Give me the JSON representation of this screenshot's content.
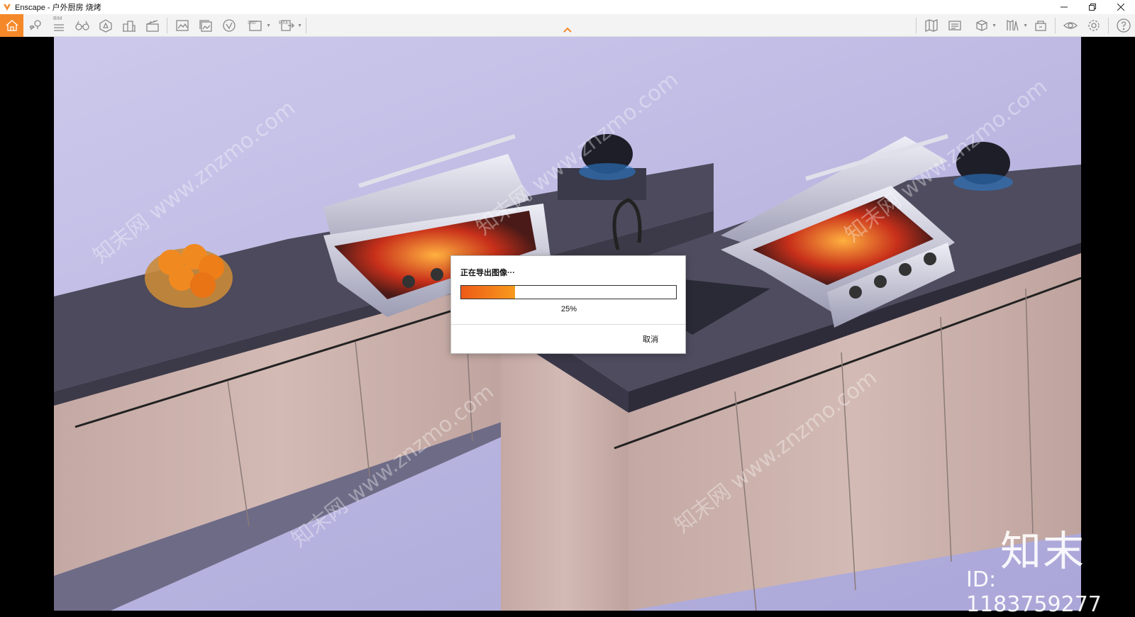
{
  "window": {
    "title": "Enscape - 户外厨房 烧烤",
    "accent_color": "#f5892a",
    "controls": [
      "minimize-icon",
      "restore-icon",
      "close-icon"
    ]
  },
  "toolbar": {
    "left_tools": [
      "home-icon",
      "location-pin-icon",
      "bim-list-icon",
      "binoculars-icon",
      "asset-library-icon",
      "buildings-icon",
      "clapperboard-icon",
      "render-screenshot-icon",
      "batch-render-icon",
      "panorama-icon",
      "panorama-360-icon",
      "export-exe-icon"
    ],
    "bim_label": "BIM",
    "pano_label": "360°",
    "exe_label": "EXE",
    "right_tools": [
      "map-icon",
      "video-editor-icon",
      "view-cube-icon",
      "material-library-icon",
      "collaboration-icon",
      "visibility-eye-icon",
      "settings-gear-icon",
      "help-icon"
    ]
  },
  "viewport": {
    "watermark_text": "知末网 www.znzmo.com",
    "brand_logo": "知末",
    "brand_id": "ID: 1183759277"
  },
  "dialog": {
    "title": "正在导出图像···",
    "progress_fraction": 0.25,
    "progress_label": "25%",
    "cancel_label": "取消"
  }
}
